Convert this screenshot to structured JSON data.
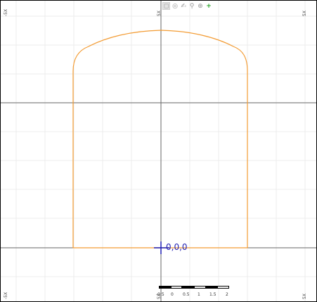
{
  "toolbar": {
    "icons": [
      "select-icon",
      "zoom-center-icon",
      "pan-icon",
      "zoom-icon",
      "crosshair-icon",
      "add-icon"
    ]
  },
  "corner_labels": {
    "top_left": "-5X",
    "top_center": "5X",
    "top_right": "5X",
    "bottom_left": "-5X",
    "bottom_center": "5X",
    "bottom_right": "5X"
  },
  "origin": {
    "label": "0,0,0"
  },
  "scale_bar": {
    "ticks": [
      "-0.5",
      "0",
      "0.5",
      "1",
      "1.5",
      "2"
    ]
  },
  "colors": {
    "shape_stroke": "#f39c34",
    "origin_marker": "#1f1fb4",
    "grid_major": "#555555",
    "grid_minor": "#e6e6e6"
  }
}
